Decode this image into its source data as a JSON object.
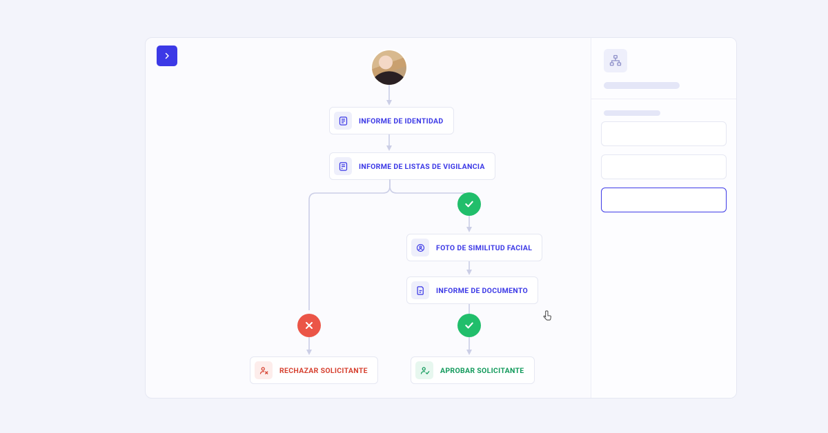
{
  "toolbar": {
    "toggle_sidebar_icon": "chevron-right"
  },
  "flow": {
    "avatar_alt": "Applicant photo",
    "nodes": {
      "identity": {
        "label": "INFORME DE IDENTIDAD",
        "icon": "identity-report"
      },
      "watchlist": {
        "label": "INFORME DE LISTAS DE VIGILANCIA",
        "icon": "watchlist-report"
      },
      "facial": {
        "label": "FOTO DE SIMILITUD FACIAL",
        "icon": "facial-similarity"
      },
      "document": {
        "label": "INFORME DE DOCUMENTO",
        "icon": "document-report"
      },
      "reject": {
        "label": "RECHAZAR SOLICITANTE",
        "icon": "reject-user"
      },
      "approve": {
        "label": "APROBAR SOLICITANTE",
        "icon": "approve-user"
      }
    },
    "decisions": {
      "pass_watchlist": "pass",
      "fail_watchlist": "fail",
      "pass_document": "pass"
    }
  },
  "side_panel": {
    "header_icon": "org-chart",
    "cards_count": 3,
    "selected_index": 2
  },
  "colors": {
    "accent": "#3C39E6",
    "success": "#21BE6B",
    "danger": "#EB5547",
    "success_text": "#129A5B",
    "danger_text": "#D6402F"
  }
}
